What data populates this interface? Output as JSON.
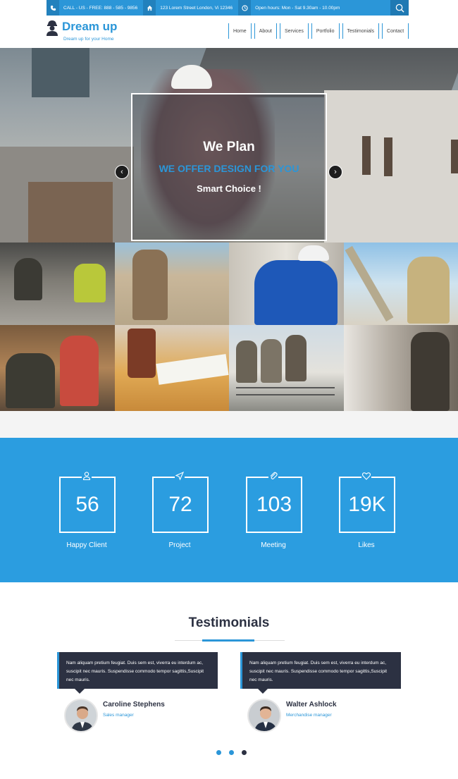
{
  "topbar": {
    "phone": "CALL - US - FREE:  888 - 585 - 9856",
    "address": "123 Lorem Street London, Vi 12346",
    "hours": "Open hours: Mon - Sat 9.30am - 10.00pm"
  },
  "header": {
    "logo_title": "Dream up",
    "logo_tagline": "Dream up for your Home",
    "nav": [
      "Home",
      "About",
      "Services",
      "Portfolio",
      "Testimonials",
      "Contact"
    ]
  },
  "hero": {
    "title": "We Plan",
    "subtitle": "WE OFFER DESIGN FOR YOU",
    "text": "Smart Choice !",
    "prev": "‹",
    "next": "›"
  },
  "counters": [
    {
      "value": "56",
      "label": "Happy Client",
      "icon": "user-icon"
    },
    {
      "value": "72",
      "label": "Project",
      "icon": "send-icon"
    },
    {
      "value": "103",
      "label": "Meeting",
      "icon": "paperclip-icon"
    },
    {
      "value": "19K",
      "label": "Likes",
      "icon": "heart-icon"
    }
  ],
  "testimonials": {
    "title": "Testimonials",
    "items": [
      {
        "text": "Nam aliquam pretium feugiat. Duis sem est, viverra eu interdum ac, suscipit nec mauris. Suspendisse commodo tempor sagittis,Suscipit nec mauris.",
        "name": "Caroline Stephens",
        "role": "Sales manager"
      },
      {
        "text": "Nam aliquam pretium feugiat. Duis sem est, viverra eu interdum ac, suscipit nec mauris. Suspendisse commodo tempor sagittis,Suscipit nec mauris.",
        "name": "Walter Ashlock",
        "role": "Merchandise manager"
      }
    ]
  },
  "colors": {
    "brand": "#2b96d8",
    "counter_bg": "#2b9de0",
    "dark": "#2c3142"
  }
}
